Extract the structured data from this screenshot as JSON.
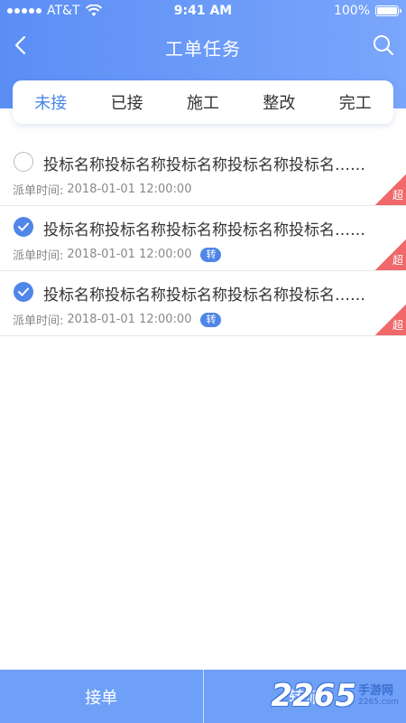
{
  "status_bar": {
    "carrier": "AT&T",
    "time": "9:41 AM",
    "battery": "100%",
    "battery_level": 1.0
  },
  "nav": {
    "title": "工单任务",
    "back_icon": "chevron-left-icon",
    "search_icon": "search-icon"
  },
  "tabs": [
    {
      "label": "未接",
      "active": true
    },
    {
      "label": "已接",
      "active": false
    },
    {
      "label": "施工",
      "active": false
    },
    {
      "label": "整改",
      "active": false
    },
    {
      "label": "完工",
      "active": false
    }
  ],
  "list": {
    "items": [
      {
        "title": "投标名称投标名称投标名称投标名称投标名……",
        "time_label": "派单时间:",
        "time": "2018-01-01 12:00:00",
        "checked": false,
        "badge": "",
        "overdue": "超"
      },
      {
        "title": "投标名称投标名称投标名称投标名称投标名……",
        "time_label": "派单时间:",
        "time": "2018-01-01 12:00:00",
        "checked": true,
        "badge": "转",
        "overdue": "超"
      },
      {
        "title": "投标名称投标名称投标名称投标名称投标名……",
        "time_label": "派单时间:",
        "time": "2018-01-01 12:00:00",
        "checked": true,
        "badge": "转",
        "overdue": "超"
      }
    ]
  },
  "bottom": {
    "accept_label": "接单",
    "transfer_label": "转派"
  },
  "watermark": {
    "number": "2265",
    "text": "手游网",
    "domain": "2265.com"
  },
  "colors": {
    "primary": "#5b8ef5",
    "accent": "#4a86e8",
    "overdue": "#f0686a",
    "bottom_bar": "#6fa0f7"
  }
}
